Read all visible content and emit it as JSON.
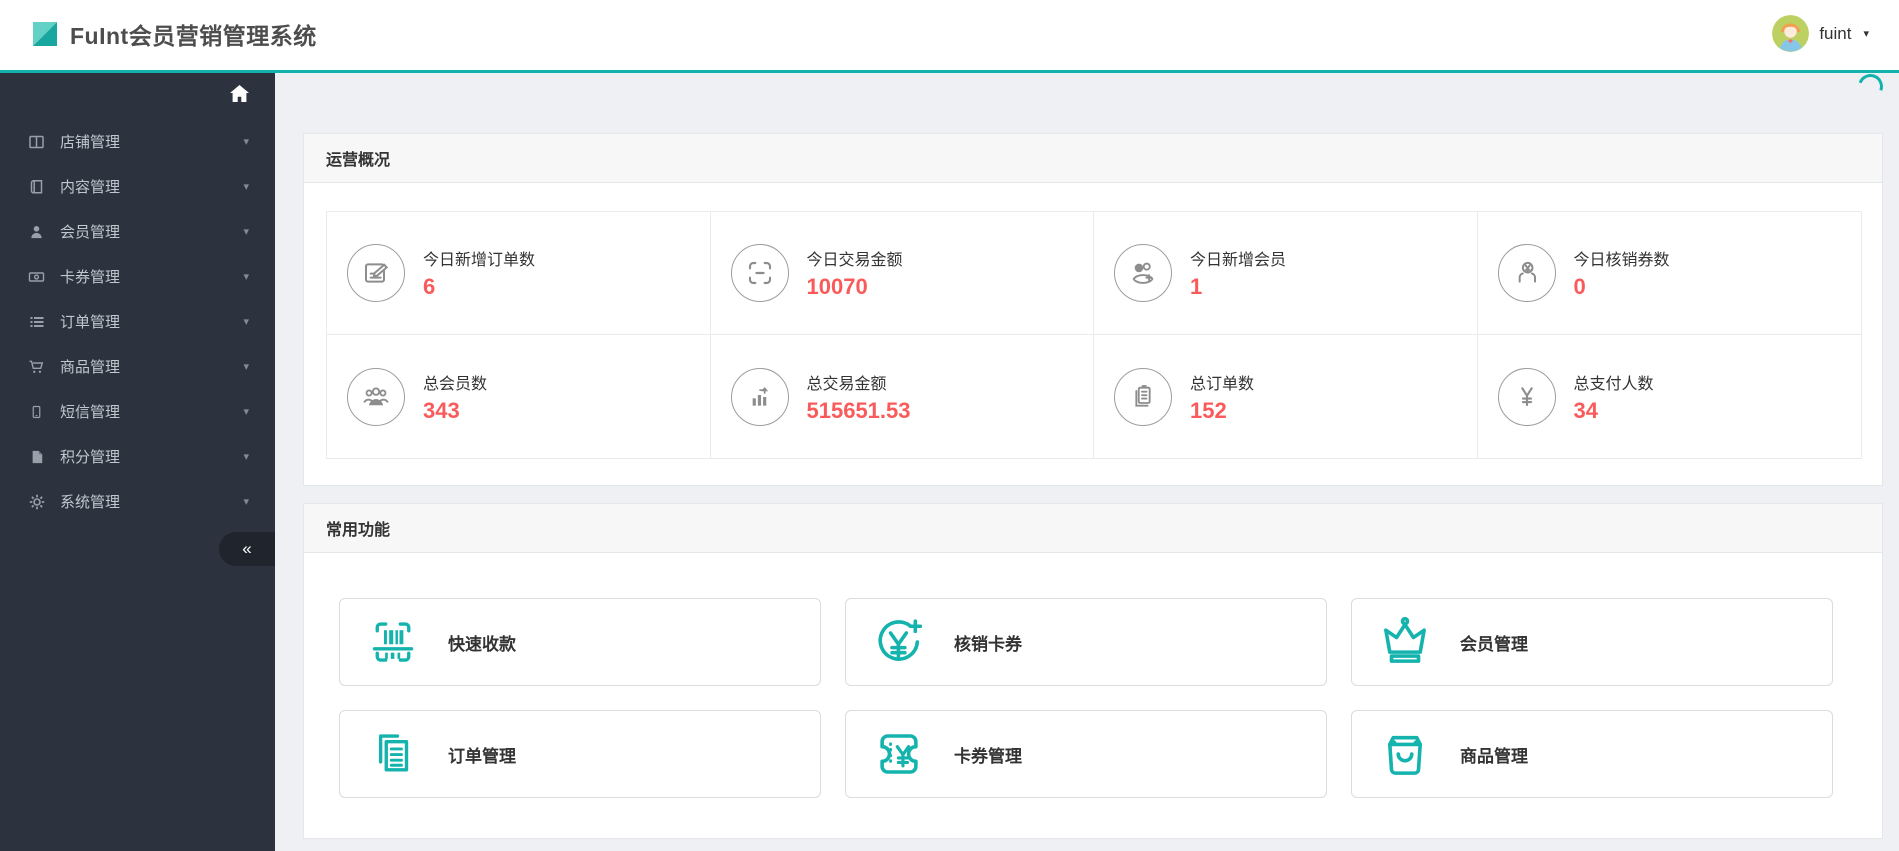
{
  "header": {
    "app_title": "FuInt会员营销管理系统",
    "user_name": "fuint"
  },
  "ui": {
    "caret_down": "▾",
    "collapse_glyph": "«"
  },
  "colors": {
    "accent_teal": "#12b2ad",
    "stat_value_red": "#f95b5b",
    "sidebar_bg": "#2d333e"
  },
  "sidebar": {
    "items": [
      {
        "label": "店铺管理",
        "icon": "columns-icon"
      },
      {
        "label": "内容管理",
        "icon": "book-icon"
      },
      {
        "label": "会员管理",
        "icon": "user-icon"
      },
      {
        "label": "卡券管理",
        "icon": "money-icon"
      },
      {
        "label": "订单管理",
        "icon": "list-icon"
      },
      {
        "label": "商品管理",
        "icon": "cart-icon"
      },
      {
        "label": "短信管理",
        "icon": "mobile-icon"
      },
      {
        "label": "积分管理",
        "icon": "file-icon"
      },
      {
        "label": "系统管理",
        "icon": "gear-icon"
      }
    ]
  },
  "overview": {
    "title": "运营概况",
    "stats": [
      {
        "label": "今日新增订单数",
        "value": "6",
        "icon": "edit-icon"
      },
      {
        "label": "今日交易金额",
        "value": "10070",
        "icon": "scan-icon"
      },
      {
        "label": "今日新增会员",
        "value": "1",
        "icon": "add-member-icon"
      },
      {
        "label": "今日核销券数",
        "value": "0",
        "icon": "hand-yen-icon"
      },
      {
        "label": "总会员数",
        "value": "343",
        "icon": "members-group-icon"
      },
      {
        "label": "总交易金额",
        "value": "515651.53",
        "icon": "bar-chart-icon"
      },
      {
        "label": "总订单数",
        "value": "152",
        "icon": "orders-doc-icon"
      },
      {
        "label": "总支付人数",
        "value": "34",
        "icon": "yen-circle-icon"
      }
    ]
  },
  "quick_actions": {
    "title": "常用功能",
    "actions": [
      {
        "label": "快速收款",
        "icon": "barcode-scan-icon"
      },
      {
        "label": "核销卡券",
        "icon": "yen-plus-icon"
      },
      {
        "label": "会员管理",
        "icon": "crown-icon"
      },
      {
        "label": "订单管理",
        "icon": "documents-icon"
      },
      {
        "label": "卡券管理",
        "icon": "coupon-icon"
      },
      {
        "label": "商品管理",
        "icon": "shopping-bag-icon"
      }
    ]
  }
}
